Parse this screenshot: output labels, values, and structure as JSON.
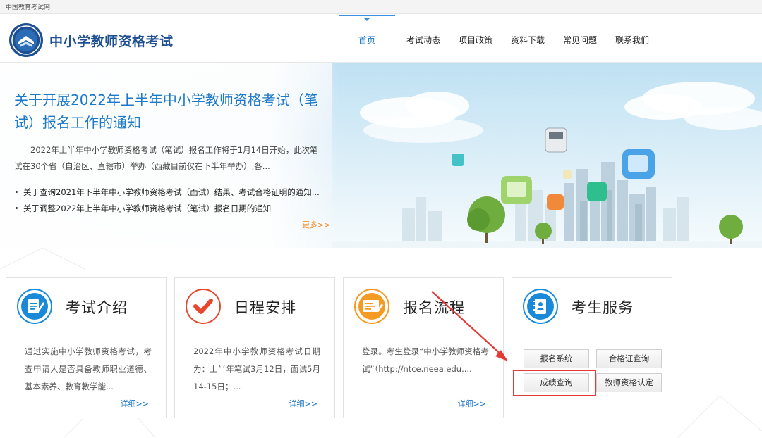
{
  "top_strip": {
    "site": "中国教育考试网"
  },
  "header": {
    "title": "中小学教师资格考试",
    "nav": [
      {
        "label": "首页",
        "active": true
      },
      {
        "label": "考试动态"
      },
      {
        "label": "项目政策"
      },
      {
        "label": "资料下载"
      },
      {
        "label": "常见问题"
      },
      {
        "label": "联系我们"
      }
    ]
  },
  "banner": {
    "headline": "关于开展2022年上半年中小学教师资格考试（笔试）报名工作的通知",
    "summary": "2022年上半年中小学教师资格考试（笔试）报名工作将于1月14日开始，此次笔试在30个省（自治区、直辖市）举办（西藏目前仅在下半年举办）,各...",
    "news": [
      "关于查询2021年下半年中小学教师资格考试（面试）结果、考试合格证明的通知...",
      "关于调整2022年上半年中小学教师资格考试（笔试）报名日期的通知"
    ],
    "more": "更多>>"
  },
  "cards": [
    {
      "title": "考试介绍",
      "body": "通过实施中小学教师资格考试，考查申请人是否具备教师职业道德、基本素养、教育教学能...",
      "more": "详细>>",
      "icon": "document-edit-icon",
      "color": "#1a8ad8"
    },
    {
      "title": "日程安排",
      "body": "2022年中小学教师资格考试日期为：上半年笔试3月12日，面试5月14-15日；...",
      "more": "详细>>",
      "icon": "checkmark-icon",
      "color": "#e8472f"
    },
    {
      "title": "报名流程",
      "body": "登录。考生登录“中小学教师资格考试”（http://ntce.neea.edu....",
      "more": "详细>>",
      "icon": "registration-form-icon",
      "color": "#f59a23"
    },
    {
      "title": "考生服务",
      "icon": "contact-book-icon",
      "color": "#1a8ad8",
      "buttons": [
        "报名系统",
        "合格证查询",
        "成绩查询",
        "教师资格认定"
      ]
    }
  ]
}
